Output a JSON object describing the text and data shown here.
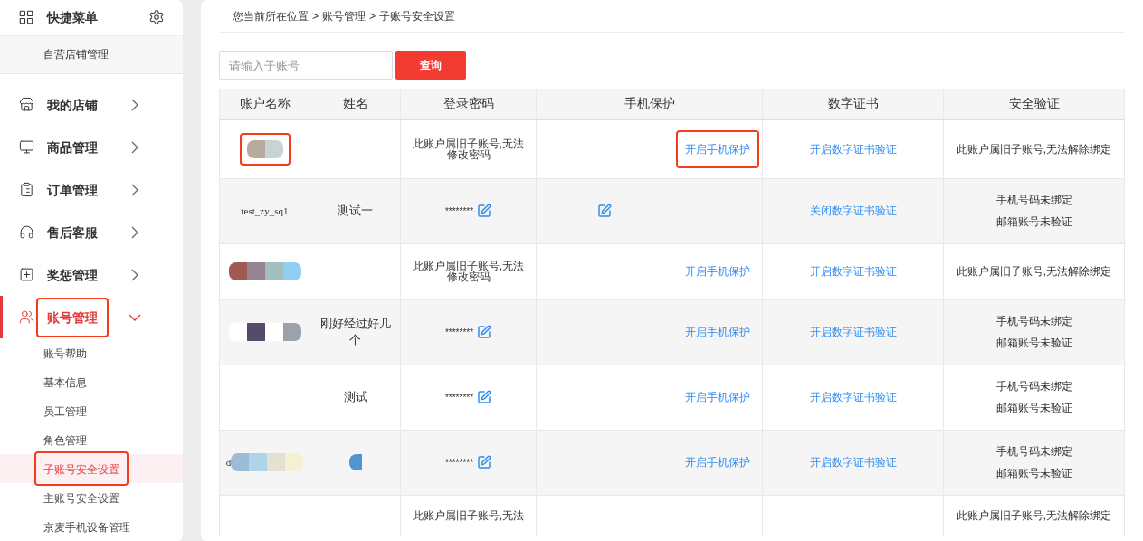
{
  "sidebar": {
    "title": "快捷菜单",
    "shortcuts": [
      {
        "label": "自营店铺管理"
      }
    ],
    "menu": [
      {
        "label": "我的店铺",
        "expanded": false,
        "selected": false,
        "highlighted": false
      },
      {
        "label": "商品管理",
        "expanded": false,
        "selected": false,
        "highlighted": false
      },
      {
        "label": "订单管理",
        "expanded": false,
        "selected": false,
        "highlighted": false
      },
      {
        "label": "售后客服",
        "expanded": false,
        "selected": false,
        "highlighted": false
      },
      {
        "label": "奖惩管理",
        "expanded": false,
        "selected": false,
        "highlighted": false
      },
      {
        "label": "账号管理",
        "expanded": true,
        "selected": true,
        "highlighted": true,
        "children": [
          {
            "label": "账号帮助",
            "selected": false,
            "highlighted": false
          },
          {
            "label": "基本信息",
            "selected": false,
            "highlighted": false
          },
          {
            "label": "员工管理",
            "selected": false,
            "highlighted": false
          },
          {
            "label": "角色管理",
            "selected": false,
            "highlighted": false
          },
          {
            "label": "子账号安全设置",
            "selected": true,
            "highlighted": true
          },
          {
            "label": "主账号安全设置",
            "selected": false,
            "highlighted": false
          },
          {
            "label": "京麦手机设备管理",
            "selected": false,
            "highlighted": false
          }
        ]
      }
    ]
  },
  "breadcrumb": [
    "您当前所在位置",
    "账号管理",
    "子账号安全设置"
  ],
  "breadcrumb_separator": ">",
  "search": {
    "placeholder": "请输入子账号",
    "button": "查询"
  },
  "table": {
    "columns": [
      "账户名称",
      "姓名",
      "登录密码",
      "手机保护",
      "数字证书",
      "安全验证"
    ],
    "rows": [
      {
        "account": {
          "redacted": true,
          "highlighted": true
        },
        "password": {
          "kind": "note",
          "text": "此账户属旧子账号,无法修改密码"
        },
        "phone_link": {
          "text": "开启手机保护",
          "highlighted": true
        },
        "cert_link": "开启数字证书验证",
        "security": [
          "此账户属旧子账号,无法解除绑定"
        ]
      },
      {
        "account": {
          "text": "test_zy_sq1"
        },
        "name": {
          "text": "测试一"
        },
        "password": {
          "kind": "masked",
          "text": "********"
        },
        "phone_edit": true,
        "cert_link": "关闭数字证书验证",
        "security": [
          "手机号码未绑定",
          "邮箱账号未验证"
        ]
      },
      {
        "account": {
          "redacted": true,
          "highlighted": false
        },
        "password": {
          "kind": "note",
          "text": "此账户属旧子账号,无法修改密码"
        },
        "phone_link": {
          "text": "开启手机保护",
          "highlighted": false
        },
        "cert_link": "开启数字证书验证",
        "security": [
          "此账户属旧子账号,无法解除绑定"
        ]
      },
      {
        "account": {
          "redacted": true,
          "highlighted": false
        },
        "name": {
          "text": "刚好经过好几个"
        },
        "password": {
          "kind": "masked",
          "text": "********"
        },
        "phone_link": {
          "text": "开启手机保护",
          "highlighted": false
        },
        "cert_link": "开启数字证书验证",
        "security": [
          "手机号码未绑定",
          "邮箱账号未验证"
        ]
      },
      {
        "name": {
          "text": "测试"
        },
        "password": {
          "kind": "masked",
          "text": "********"
        },
        "phone_link": {
          "text": "开启手机保护",
          "highlighted": false
        },
        "cert_link": "开启数字证书验证",
        "security": [
          "手机号码未绑定",
          "邮箱账号未验证"
        ]
      },
      {
        "account": {
          "text": "d",
          "redacted": true,
          "highlighted": false
        },
        "name": {
          "redacted": true
        },
        "password": {
          "kind": "masked",
          "text": "********"
        },
        "phone_link": {
          "text": "开启手机保护",
          "highlighted": false
        },
        "cert_link": "开启数字证书验证",
        "security": [
          "手机号码未绑定",
          "邮箱账号未验证"
        ]
      },
      {
        "password": {
          "kind": "note",
          "text": "此账户属旧子账号,无法"
        },
        "security": [
          "此账户属旧子账号,无法解除绑定"
        ]
      }
    ]
  }
}
